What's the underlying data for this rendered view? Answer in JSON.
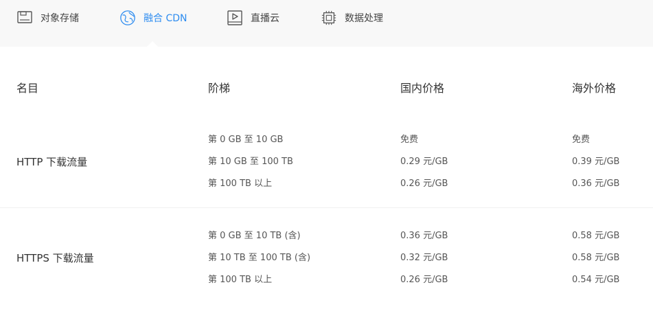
{
  "tabs": [
    {
      "label": "对象存储",
      "icon": "storage-icon"
    },
    {
      "label": "融合 CDN",
      "icon": "globe-icon"
    },
    {
      "label": "直播云",
      "icon": "play-icon"
    },
    {
      "label": "数据处理",
      "icon": "chip-icon"
    }
  ],
  "active_tab": 1,
  "colors": {
    "accent": "#2d8cf0",
    "tab_bar_bg": "#f8f8f8"
  },
  "table": {
    "headers": [
      "名目",
      "阶梯",
      "国内价格",
      "海外价格"
    ],
    "groups": [
      {
        "name": "HTTP 下载流量",
        "rows": [
          {
            "tier": "第 0 GB 至 10 GB",
            "domestic": "免费",
            "overseas": "免费"
          },
          {
            "tier": "第 10 GB 至 100 TB",
            "domestic": "0.29 元/GB",
            "overseas": "0.39 元/GB"
          },
          {
            "tier": "第 100 TB 以上",
            "domestic": "0.26 元/GB",
            "overseas": "0.36 元/GB"
          }
        ]
      },
      {
        "name": "HTTPS 下载流量",
        "rows": [
          {
            "tier": "第 0 GB 至 10 TB (含)",
            "domestic": "0.36 元/GB",
            "overseas": "0.58 元/GB"
          },
          {
            "tier": "第 10 TB 至 100 TB (含)",
            "domestic": "0.32 元/GB",
            "overseas": "0.58 元/GB"
          },
          {
            "tier": "第 100 TB 以上",
            "domestic": "0.26 元/GB",
            "overseas": "0.54 元/GB"
          }
        ]
      }
    ]
  }
}
